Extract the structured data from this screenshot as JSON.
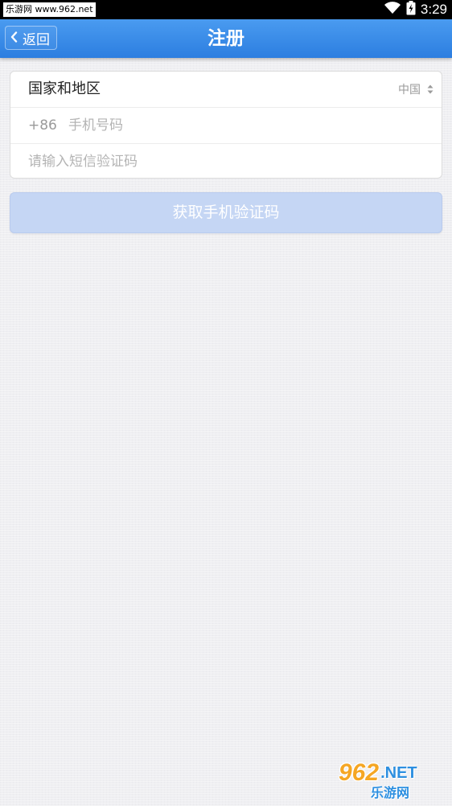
{
  "status_bar": {
    "watermark_text": "乐游网 www.962.net",
    "time": "3:29",
    "icons": [
      "wifi-icon",
      "battery-icon"
    ]
  },
  "nav": {
    "back_label": "返回",
    "title": "注册"
  },
  "form": {
    "country_label": "国家和地区",
    "country_value": "中国",
    "phone_prefix": "+86",
    "phone_placeholder": "手机号码",
    "code_placeholder": "请输入短信验证码"
  },
  "actions": {
    "get_code_label": "获取手机验证码"
  },
  "watermark_logo": {
    "number": "962",
    "suffix": ".NET",
    "text": "乐游网"
  },
  "colors": {
    "nav_bar": "#3a8de8",
    "button_disabled": "#c5d6f4",
    "watermark_orange": "#f5a623",
    "watermark_blue": "#2d8fe0"
  }
}
